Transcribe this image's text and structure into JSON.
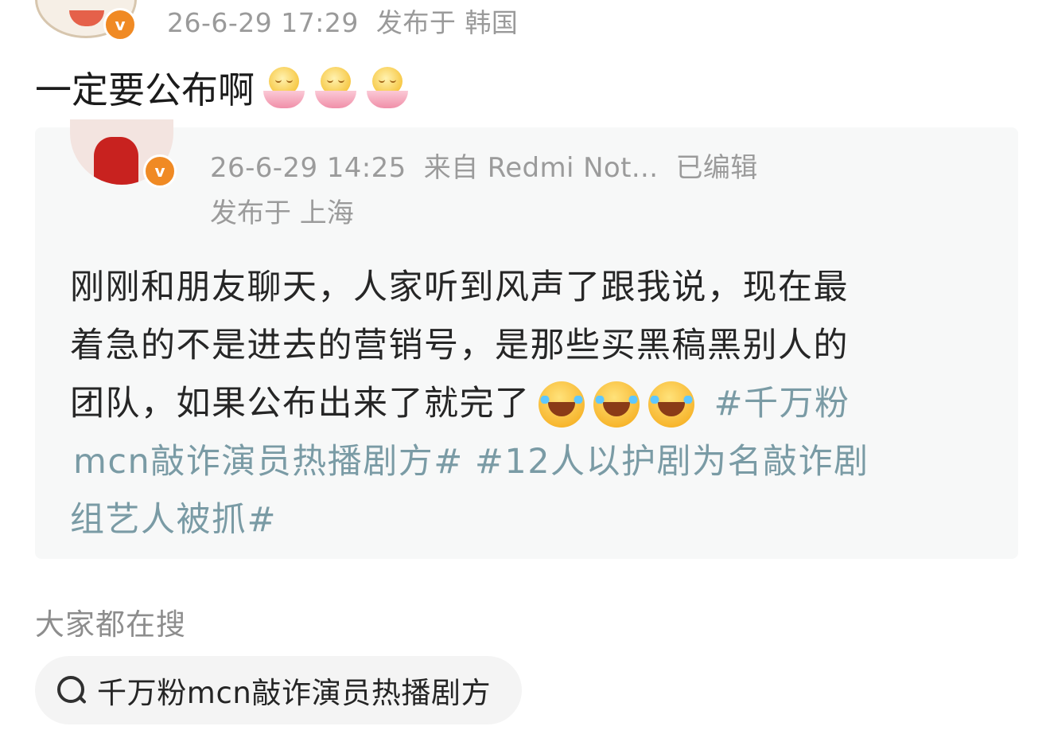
{
  "post": {
    "time": "26-6-29 17:29",
    "location": "发布于 韩国",
    "text": "一定要公布啊",
    "emoji": [
      "lotus-face",
      "lotus-face",
      "lotus-face"
    ]
  },
  "quoted": {
    "time": "26-6-29 14:25",
    "source": "来自 Redmi Not...",
    "edited": "已编辑",
    "location": "发布于 上海",
    "lines": [
      "刚刚和朋友聊天，人家听到风声了跟我说，现在最",
      "着急的不是进去的营销号，是那些买黑稿黑别人的",
      "团队，如果公布出来了就完了"
    ],
    "line3_topic": "#千万粉",
    "line4_topic_a": "mcn敲诈演员热播剧方#",
    "line4_topic_b": "#12人以护剧为名敲诈剧",
    "line5_topic": "组艺人被抓#",
    "laugh_emoji": [
      "laughing-tears",
      "laughing-tears",
      "laughing-tears"
    ]
  },
  "search": {
    "heading": "大家都在搜",
    "query": "千万粉mcn敲诈演员热播剧方"
  },
  "colors": {
    "topic": "#7a9ba5",
    "meta": "#9a9a9a",
    "badge": "#f08a24"
  }
}
